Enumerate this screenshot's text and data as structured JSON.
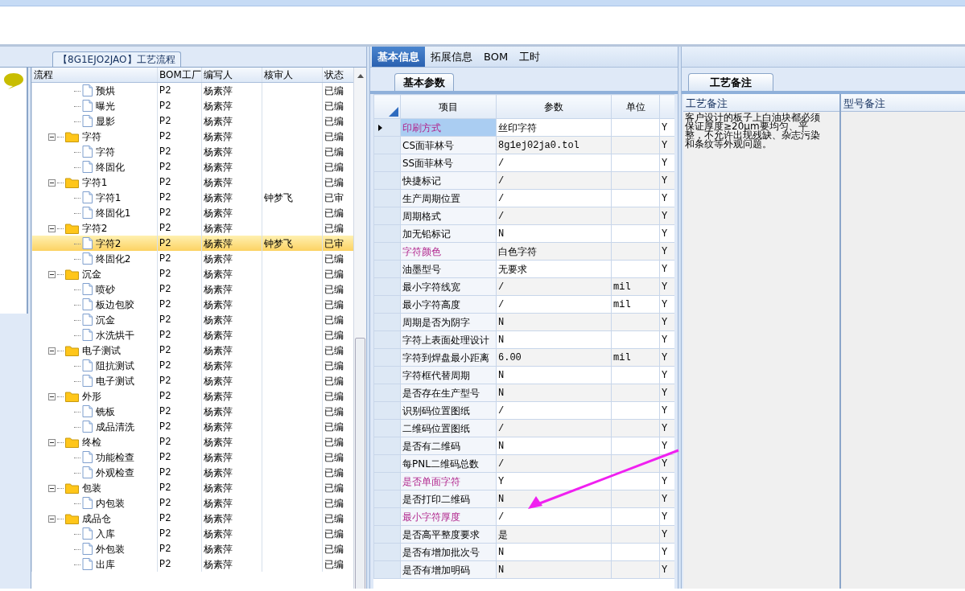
{
  "flow_panel": {
    "tab": "【8G1EJO2JAO】工艺流程",
    "columns": [
      "流程",
      "BOM工厂",
      "编写人",
      "核审人",
      "状态"
    ],
    "tree": [
      {
        "children": [
          {
            "label": "预烘",
            "bom": "P2",
            "author": "杨素萍",
            "status": "已编",
            "selected": false
          },
          {
            "label": "曝光",
            "bom": "P2",
            "author": "杨素萍",
            "status": "已编",
            "selected": false
          },
          {
            "label": "显影",
            "bom": "P2",
            "author": "杨素萍",
            "status": "已编",
            "selected": false
          }
        ]
      },
      {
        "label": "字符",
        "bom": "P2",
        "author": "杨素萍",
        "status": "已编",
        "expanded": true,
        "selected": false,
        "children": [
          {
            "label": "字符",
            "bom": "P2",
            "author": "杨素萍",
            "status": "已编",
            "selected": false
          },
          {
            "label": "终固化",
            "bom": "P2",
            "author": "杨素萍",
            "status": "已编",
            "selected": false
          }
        ]
      },
      {
        "label": "字符1",
        "bom": "P2",
        "author": "杨素萍",
        "status": "已编",
        "expanded": true,
        "selected": false,
        "children": [
          {
            "label": "字符1",
            "bom": "P2",
            "author": "杨素萍",
            "reviewer": "钟梦飞",
            "status": "已审",
            "selected": false
          },
          {
            "label": "终固化1",
            "bom": "P2",
            "author": "杨素萍",
            "status": "已编",
            "selected": false
          }
        ]
      },
      {
        "label": "字符2",
        "bom": "P2",
        "author": "杨素萍",
        "status": "已编",
        "expanded": true,
        "selected": false,
        "children": [
          {
            "label": "字符2",
            "bom": "P2",
            "author": "杨素萍",
            "reviewer": "钟梦飞",
            "status": "已审",
            "selected": true
          },
          {
            "label": "终固化2",
            "bom": "P2",
            "author": "杨素萍",
            "status": "已编",
            "selected": false
          }
        ]
      },
      {
        "label": "沉金",
        "bom": "P2",
        "author": "杨素萍",
        "status": "已编",
        "expanded": true,
        "selected": false,
        "children": [
          {
            "label": "喷砂",
            "bom": "P2",
            "author": "杨素萍",
            "status": "已编",
            "selected": false
          },
          {
            "label": "板边包胶",
            "bom": "P2",
            "author": "杨素萍",
            "status": "已编",
            "selected": false
          },
          {
            "label": "沉金",
            "bom": "P2",
            "author": "杨素萍",
            "status": "已编",
            "selected": false
          },
          {
            "label": "水洗烘干",
            "bom": "P2",
            "author": "杨素萍",
            "status": "已编",
            "selected": false
          }
        ]
      },
      {
        "label": "电子测试",
        "bom": "P2",
        "author": "杨素萍",
        "status": "已编",
        "expanded": true,
        "selected": false,
        "children": [
          {
            "label": "阻抗测试",
            "bom": "P2",
            "author": "杨素萍",
            "status": "已编",
            "selected": false
          },
          {
            "label": "电子测试",
            "bom": "P2",
            "author": "杨素萍",
            "status": "已编",
            "selected": false
          }
        ]
      },
      {
        "label": "外形",
        "bom": "P2",
        "author": "杨素萍",
        "status": "已编",
        "expanded": true,
        "selected": false,
        "children": [
          {
            "label": "铣板",
            "bom": "P2",
            "author": "杨素萍",
            "status": "已编",
            "selected": false
          },
          {
            "label": "成品清洗",
            "bom": "P2",
            "author": "杨素萍",
            "status": "已编",
            "selected": false
          }
        ]
      },
      {
        "label": "终检",
        "bom": "P2",
        "author": "杨素萍",
        "status": "已编",
        "expanded": true,
        "selected": false,
        "children": [
          {
            "label": "功能检查",
            "bom": "P2",
            "author": "杨素萍",
            "status": "已编",
            "selected": false
          },
          {
            "label": "外观检查",
            "bom": "P2",
            "author": "杨素萍",
            "status": "已编",
            "selected": false
          }
        ]
      },
      {
        "label": "包装",
        "bom": "P2",
        "author": "杨素萍",
        "status": "已编",
        "expanded": true,
        "selected": false,
        "children": [
          {
            "label": "内包装",
            "bom": "P2",
            "author": "杨素萍",
            "status": "已编",
            "selected": false
          }
        ]
      },
      {
        "label": "成品仓",
        "bom": "P2",
        "author": "杨素萍",
        "status": "已编",
        "expanded": true,
        "selected": false,
        "children": [
          {
            "label": "入库",
            "bom": "P2",
            "author": "杨素萍",
            "status": "已编",
            "selected": false
          },
          {
            "label": "外包装",
            "bom": "P2",
            "author": "杨素萍",
            "status": "已编",
            "selected": false
          },
          {
            "label": "出库",
            "bom": "P2",
            "author": "杨素萍",
            "status": "已编",
            "selected": false
          }
        ]
      }
    ]
  },
  "info_panel": {
    "tabs": [
      {
        "label": "基本信息",
        "selected": true
      },
      {
        "label": "拓展信息",
        "selected": false
      },
      {
        "label": "BOM",
        "selected": false
      },
      {
        "label": "工时",
        "selected": false
      }
    ],
    "subtab": "基本参数",
    "columns": [
      "项目",
      "参数",
      "单位"
    ],
    "rows": [
      {
        "item": "印刷方式",
        "value": "丝印字符",
        "unit": "",
        "flag": "Y",
        "highlighted": true,
        "selected": true
      },
      {
        "item": "CS面菲林号",
        "value": "8g1ej02ja0.tol",
        "unit": "",
        "flag": "Y",
        "highlighted": false,
        "selected": false
      },
      {
        "item": "SS面菲林号",
        "value": "/",
        "unit": "",
        "flag": "Y",
        "highlighted": false,
        "selected": false
      },
      {
        "item": "快捷标记",
        "value": "/",
        "unit": "",
        "flag": "Y",
        "highlighted": false,
        "selected": false
      },
      {
        "item": "生产周期位置",
        "value": "/",
        "unit": "",
        "flag": "Y",
        "highlighted": false,
        "selected": false
      },
      {
        "item": "周期格式",
        "value": "/",
        "unit": "",
        "flag": "Y",
        "highlighted": false,
        "selected": false
      },
      {
        "item": "加无铅标记",
        "value": "N",
        "unit": "",
        "flag": "Y",
        "highlighted": false,
        "selected": false
      },
      {
        "item": "字符颜色",
        "value": "白色字符",
        "unit": "",
        "flag": "Y",
        "highlighted": true,
        "selected": false
      },
      {
        "item": "油墨型号",
        "value": "无要求",
        "unit": "",
        "flag": "Y",
        "highlighted": false,
        "selected": false
      },
      {
        "item": "最小字符线宽",
        "value": "/",
        "unit": "mil",
        "flag": "Y",
        "highlighted": false,
        "selected": false
      },
      {
        "item": "最小字符高度",
        "value": "/",
        "unit": "mil",
        "flag": "Y",
        "highlighted": false,
        "selected": false
      },
      {
        "item": "周期是否为阴字",
        "value": "N",
        "unit": "",
        "flag": "Y",
        "highlighted": false,
        "selected": false
      },
      {
        "item": "字符上表面处理设计",
        "value": "N",
        "unit": "",
        "flag": "Y",
        "highlighted": false,
        "selected": false
      },
      {
        "item": "字符到焊盘最小距离",
        "value": "6.00",
        "unit": "mil",
        "flag": "Y",
        "highlighted": false,
        "selected": false
      },
      {
        "item": "字符框代替周期",
        "value": "N",
        "unit": "",
        "flag": "Y",
        "highlighted": false,
        "selected": false
      },
      {
        "item": "是否存在生产型号",
        "value": "N",
        "unit": "",
        "flag": "Y",
        "highlighted": false,
        "selected": false
      },
      {
        "item": "识别码位置图纸",
        "value": "/",
        "unit": "",
        "flag": "Y",
        "highlighted": false,
        "selected": false
      },
      {
        "item": "二维码位置图纸",
        "value": "/",
        "unit": "",
        "flag": "Y",
        "highlighted": false,
        "selected": false
      },
      {
        "item": "是否有二维码",
        "value": "N",
        "unit": "",
        "flag": "Y",
        "highlighted": false,
        "selected": false
      },
      {
        "item": "每PNL二维码总数",
        "value": "/",
        "unit": "",
        "flag": "Y",
        "highlighted": false,
        "selected": false
      },
      {
        "item": "是否单面字符",
        "value": "Y",
        "unit": "",
        "flag": "Y",
        "highlighted": true,
        "selected": false
      },
      {
        "item": "是否打印二维码",
        "value": "N",
        "unit": "",
        "flag": "Y",
        "highlighted": false,
        "selected": false
      },
      {
        "item": "最小字符厚度",
        "value": "/",
        "unit": "",
        "flag": "Y",
        "highlighted": true,
        "selected": false
      },
      {
        "item": "是否高平整度要求",
        "value": "是",
        "unit": "",
        "flag": "Y",
        "highlighted": false,
        "selected": false
      },
      {
        "item": "是否有增加批次号",
        "value": "N",
        "unit": "",
        "flag": "Y",
        "highlighted": false,
        "selected": false
      },
      {
        "item": "是否有增加明码",
        "value": "N",
        "unit": "",
        "flag": "Y",
        "highlighted": false,
        "selected": false
      }
    ]
  },
  "notes_panel": {
    "tab": "工艺备注",
    "columns": [
      "工艺备注",
      "型号备注"
    ],
    "process_note": "客户设计的板子上白油块都必须保证厚度≥20μm要均匀、平整，不允许出现残缺、杂志污染和条纹等外观问题。"
  }
}
